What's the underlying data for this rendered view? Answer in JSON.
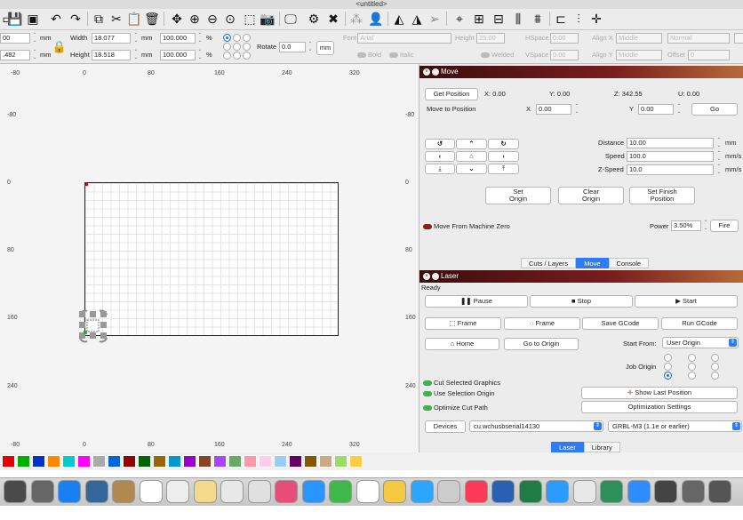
{
  "window": {
    "title": "<untitled>"
  },
  "toolbar": {
    "icons": [
      "new-file-icon",
      "save-icon",
      "save-as-icon",
      "undo-icon",
      "redo-icon",
      "copy-icon",
      "cut-icon",
      "paste-icon",
      "delete-icon",
      "move-icon",
      "zoom-in-icon",
      "zoom-out-icon",
      "zoom-fit-icon",
      "select-frame-icon",
      "camera-icon",
      "monitor-icon",
      "settings-icon",
      "tools-icon",
      "group-icon",
      "user-icon",
      "mirror-h-icon",
      "mirror-v-icon",
      "send-icon",
      "target-icon",
      "align-icon",
      "distribute-icon",
      "sliders-icon",
      "grid-icon",
      "split-icon",
      "center-icon"
    ]
  },
  "props": {
    "x_value": "00",
    "y_value": ".482",
    "mm": "mm",
    "pct": "%",
    "width_label": "Width",
    "width_value": "18.077",
    "height_label": "Height",
    "height_value": "18.518",
    "scale_w": "100.000",
    "scale_h": "100.000",
    "rotate_label": "Rotate",
    "rotate_value": "0.0",
    "font_label": "Font",
    "font_value": "Arial",
    "text_height_label": "Height",
    "text_height_value": "25.00",
    "hspace_label": "HSpace",
    "hspace_value": "0.00",
    "vspace_label": "VSpace",
    "vspace_value": "0.00",
    "alignx_label": "Align X",
    "alignx_value": "Middle",
    "aligny_label": "Align Y",
    "aligny_value": "Middle",
    "style_value": "Normal",
    "offset_label": "Offset",
    "offset_value": "0",
    "bold_label": "Bold",
    "italic_label": "Italic",
    "welded_label": "Welded"
  },
  "ruler": {
    "top": [
      "-80",
      "0",
      "80",
      "160",
      "240",
      "320"
    ],
    "bottom": [
      "-80",
      "0",
      "80",
      "160",
      "240",
      "320"
    ],
    "left": [
      "-80",
      "0",
      "80",
      "160",
      "240"
    ],
    "right": [
      "-80",
      "0",
      "80",
      "160",
      "240"
    ]
  },
  "move": {
    "title": "Move",
    "get_position": "Get Position",
    "x_pos": "X: 0.00",
    "y_pos": "Y: 0.00",
    "z_pos": "Z: 342.55",
    "u_pos": "U: 0.00",
    "move_to_position": "Move to Position",
    "x_label": "X",
    "x_input": "0.00",
    "y_label": "Y",
    "y_input": "0.00",
    "go": "Go",
    "distance_label": "Distance",
    "distance_value": "10.00",
    "distance_unit": "mm",
    "speed_label": "Speed",
    "speed_value": "100.0",
    "speed_unit": "mm/s",
    "zspeed_label": "Z-Speed",
    "zspeed_value": "10.0",
    "zspeed_unit": "mm/s",
    "set_origin": [
      "Set",
      "Origin"
    ],
    "clear_origin": [
      "Clear",
      "Origin"
    ],
    "set_finish": [
      "Set Finish",
      "Position"
    ],
    "machine_zero": "Move From Machine Zero",
    "power_label": "Power",
    "power_value": "3.50%",
    "fire": "Fire"
  },
  "tabs_top": [
    "Cuts / Layers",
    "Move",
    "Console"
  ],
  "laser": {
    "title": "Laser",
    "status": "Ready",
    "pause": "Pause",
    "stop": "Stop",
    "start": "Start",
    "frame1": "Frame",
    "frame2": "Frame",
    "save_gcode": "Save GCode",
    "run_gcode": "Run GCode",
    "home": "Home",
    "go_to_origin": "Go to Origin",
    "start_from_label": "Start From:",
    "start_from_value": "User Origin",
    "job_origin_label": "Job Origin",
    "cut_selected": "Cut Selected Graphics",
    "use_selection_origin": "Use Selection Origin",
    "optimize_cut_path": "Optimize Cut Path",
    "show_last_position": "Show Last Position",
    "optimization_settings": "Optimization Settings",
    "devices": "Devices",
    "port_value": "cu.wchusbserial14130",
    "device_value": "GRBL-M3 (1.1e or earlier)"
  },
  "tabs_bottom": [
    "Laser",
    "Library"
  ],
  "palette": [
    "#e60000",
    "#00b000",
    "#0033cc",
    "#ff8800",
    "#00cccc",
    "#ff00ff",
    "#aaaaaa",
    "#0066dd",
    "#990000",
    "#006600",
    "#996600",
    "#0099cc",
    "#9900cc",
    "#884422",
    "#aa44ff",
    "#66aa66",
    "#ff99aa",
    "#ffccee",
    "#99ccff",
    "#660066",
    "#885500",
    "#ccaa88",
    "#99dd66",
    "#ffcc44"
  ],
  "dock": [
    "#4a4a4a",
    "#666",
    "#1a7ff0",
    "#336699",
    "#b08850",
    "#ffffff",
    "#eeeeee",
    "#f3d98a",
    "#e8e8e8",
    "#e0e0e0",
    "#e84d7a",
    "#2a95ff",
    "#3fb84a",
    "#ffffff",
    "#f5c842",
    "#2aa6ff",
    "#cccccc",
    "#fa3a57",
    "#2b5fb4",
    "#1f7c44",
    "#2a9bff",
    "#e8e8e8",
    "#2d8f5b",
    "#2d8cff",
    "#444444",
    "#666666",
    "#555555"
  ]
}
